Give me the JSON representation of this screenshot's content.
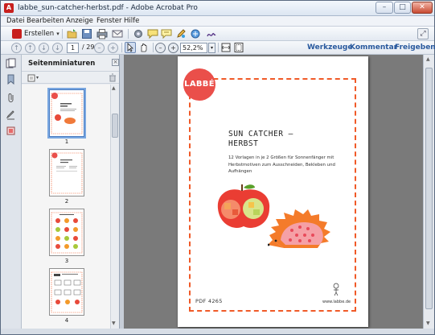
{
  "window": {
    "title": "labbe_sun-catcher-herbst.pdf - Adobe Acrobat Pro",
    "app_icon": "acrobat-icon",
    "controls": {
      "minimize": "–",
      "maximize": "□",
      "close": "✕"
    }
  },
  "menu": {
    "items": [
      "Datei",
      "Bearbeiten",
      "Anzeige",
      "Fenster",
      "Hilfe"
    ]
  },
  "toolbar": {
    "create_label": "Erstellen",
    "create_caret": "▾",
    "expand": "⤢"
  },
  "navigation": {
    "page_current": "1",
    "page_total": "/ 29",
    "zoom_value": "52,2%",
    "zoom_caret": "▾",
    "minus": "–",
    "plus": "+"
  },
  "task_links": {
    "tools": "Werkzeuge",
    "comment": "Kommentar",
    "share": "Freigeben"
  },
  "sidebar": {
    "title": "Seitenminiaturen",
    "close": "×",
    "options_caret": "▾",
    "thumbnails": [
      {
        "label": "1"
      },
      {
        "label": "2"
      },
      {
        "label": "3"
      },
      {
        "label": "4"
      }
    ]
  },
  "document": {
    "brand": "LABBÉ",
    "title_line1": "SUN CATCHER –",
    "title_line2": "HERBST",
    "subtitle": "12 Vorlagen in je 2 Größen für Sonnenfänger mit Herbstmotiven zum Ausschneiden, Bekleben und Aufhängen",
    "footer_code": "PDF 4265",
    "url": "www.labbe.de"
  },
  "colors": {
    "accent_red": "#ea4f4a",
    "dash_orange": "#f05a28",
    "link_blue": "#2a5a9e"
  }
}
